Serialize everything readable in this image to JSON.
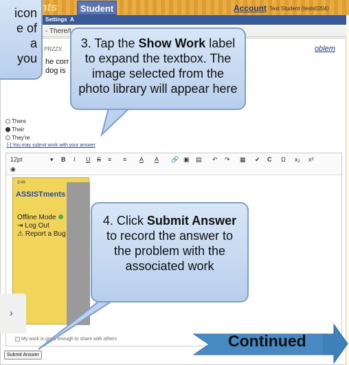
{
  "header": {
    "brand": "nts",
    "student_tab": "Student",
    "account_link": "Account",
    "user_name": "Test Student (tests0204)",
    "settings": "Settings",
    "settings_trail": "A"
  },
  "breadcrumb": "- There/t",
  "problem": {
    "id_label": "PRZZX",
    "problem_link": "oblem",
    "question_line1": "he corr",
    "question_line2": "dog is"
  },
  "choices": [
    "There",
    "Their",
    "They're"
  ],
  "selected_choice": "Their",
  "submit_work_link": "[-] You may submit work with your answer",
  "editor": {
    "font_size": "12pt",
    "format_buttons": [
      "B",
      "I",
      "U",
      "S",
      "≡",
      "≡",
      "A",
      "A"
    ],
    "preview": {
      "status_time": "3:49",
      "logo": "ASSISTments",
      "offline_mode": "Offline Mode",
      "log_out": "Log Out",
      "report_bug": "Report a Bug"
    }
  },
  "share_checkbox_label": "My work is good enough to share with others",
  "submit_button": "Submit Answer",
  "callout_partial": {
    "lines": [
      "icon",
      "e of",
      "a",
      "you"
    ]
  },
  "callout_show_work": {
    "prefix": "3. Tap the ",
    "bold": "Show Work",
    "suffix": " label to expand the textbox. The image selected from the photo library will appear here"
  },
  "callout_submit": {
    "prefix": "4. Click ",
    "bold": "Submit Answer",
    "suffix": " to record the answer to the problem with the associated work"
  },
  "continued_label": "Continued",
  "colors": {
    "header_orange": "#e8a634",
    "student_tab_blue": "#5a74b5",
    "callout_blue": "#c6d9f1",
    "arrow_blue": "#3e80b9",
    "preview_yellow": "#f1d55a"
  }
}
